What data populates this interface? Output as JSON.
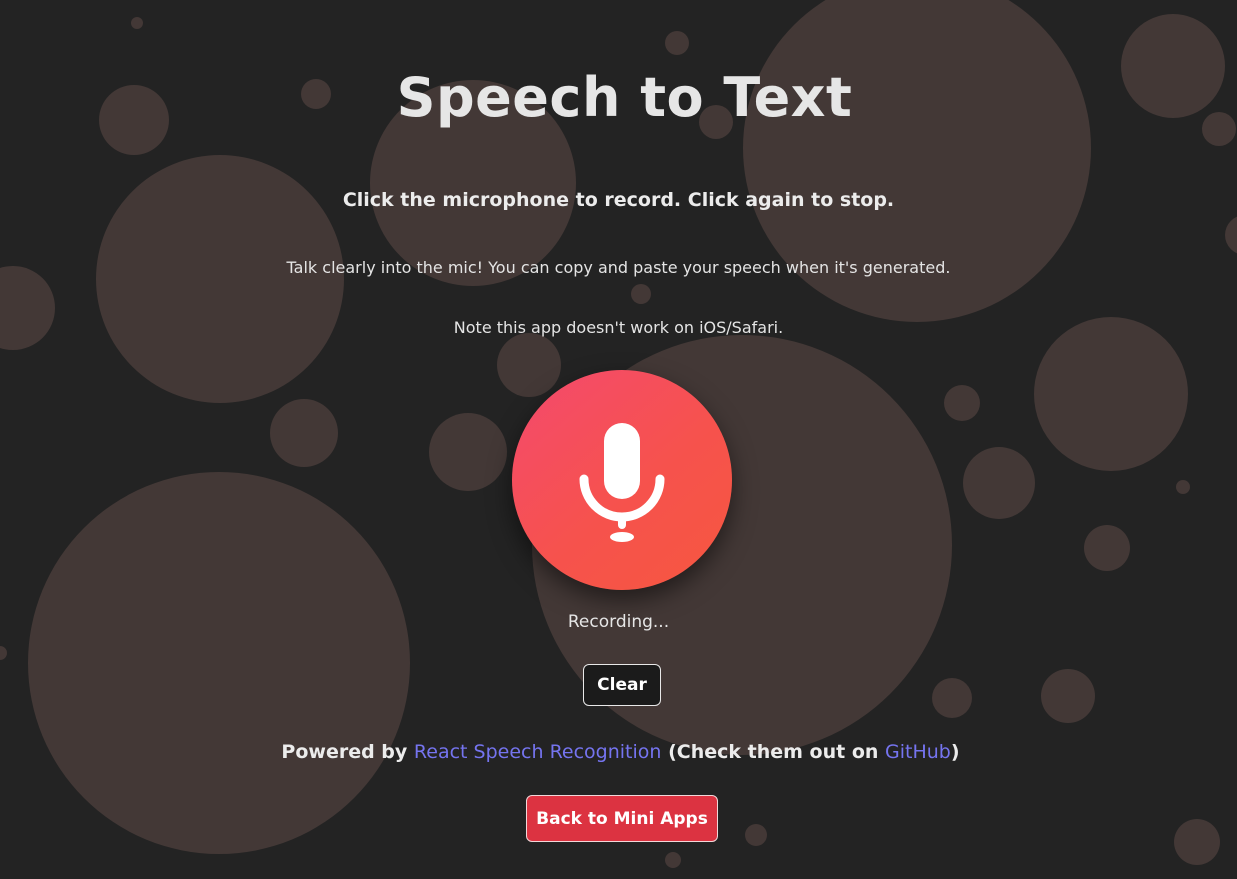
{
  "page": {
    "title": "Speech to Text",
    "instruction": "Click the microphone to record. Click again to stop.",
    "tip": "Talk clearly into the mic! You can copy and paste your speech when it's generated.",
    "compatibility_note": "Note this app doesn't work on iOS/Safari."
  },
  "recorder": {
    "icon": "microphone-icon",
    "status": "Recording...",
    "clear_label": "Clear"
  },
  "credits": {
    "prefix": "Powered by",
    "library_link": "React Speech Recognition",
    "middle": "(Check them out on",
    "github_link": "GitHub",
    "suffix": ")"
  },
  "navigation": {
    "back_label": "Back to Mini Apps"
  },
  "colors": {
    "background": "#232323",
    "bubble": "#433836",
    "mic_gradient_start": "#f44a6e",
    "mic_gradient_end": "#f7573f",
    "link": "#7574ef",
    "back_button": "#dc3341"
  }
}
